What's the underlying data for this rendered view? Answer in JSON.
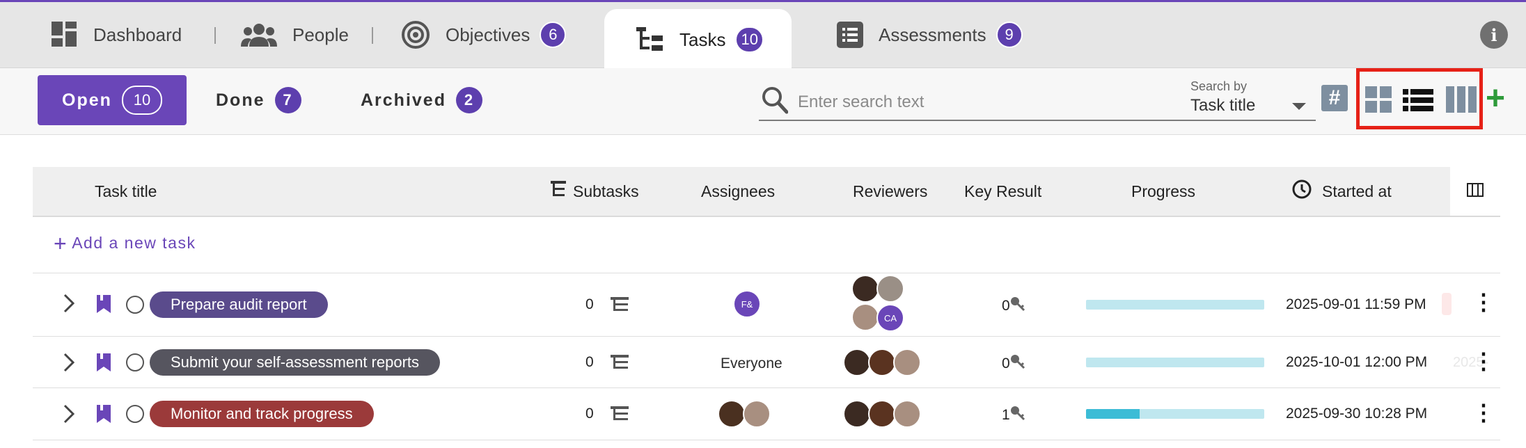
{
  "tabs": [
    {
      "label": "Dashboard",
      "icon": "dashboard-icon"
    },
    {
      "label": "People",
      "icon": "people-icon"
    },
    {
      "label": "Objectives",
      "icon": "target-icon",
      "badge": "6"
    },
    {
      "label": "Tasks",
      "icon": "tasks-tree-icon",
      "badge": "10",
      "active": true
    },
    {
      "label": "Assessments",
      "icon": "assessment-list-icon",
      "badge": "9"
    }
  ],
  "status_tabs": [
    {
      "label": "Open",
      "count": "10",
      "active": true
    },
    {
      "label": "Done",
      "count": "7"
    },
    {
      "label": "Archived",
      "count": "2"
    }
  ],
  "search": {
    "placeholder": "Enter search text",
    "search_by_label": "Search by",
    "search_by_value": "Task title"
  },
  "table": {
    "headers": {
      "task_title": "Task title",
      "subtasks": "Subtasks",
      "assignees": "Assignees",
      "reviewers": "Reviewers",
      "key_result": "Key Result",
      "progress": "Progress",
      "started_at": "Started at"
    },
    "add_task_label": "Add a new task",
    "rows": [
      {
        "title": "Prepare audit report",
        "title_color": "#5a4b8c",
        "subtasks": "0",
        "assignees_text": "",
        "assignee_initials": "F&",
        "reviewer_initials": "CA",
        "key_results": "0",
        "progress": 0,
        "started_at": "2025-09-01 11:59 PM",
        "ghost_text": ""
      },
      {
        "title": "Submit your self-assessment reports",
        "title_color": "#56555f",
        "subtasks": "0",
        "assignees_text": "Everyone",
        "key_results": "0",
        "progress": 0,
        "started_at": "2025-10-01 12:00 PM",
        "ghost_text": "2025-"
      },
      {
        "title": "Monitor and track progress",
        "title_color": "#9b3a3a",
        "subtasks": "0",
        "assignees_text": "",
        "key_results": "1",
        "progress": 0.3,
        "started_at": "2025-09-30 10:28 PM",
        "ghost_text": ""
      }
    ]
  },
  "colors": {
    "accent": "#6a46b8",
    "highlight_box": "#e62117",
    "add_button": "#2e9b3a",
    "progress_track": "#bfe7ef",
    "progress_fill": "#3cbcd6"
  }
}
